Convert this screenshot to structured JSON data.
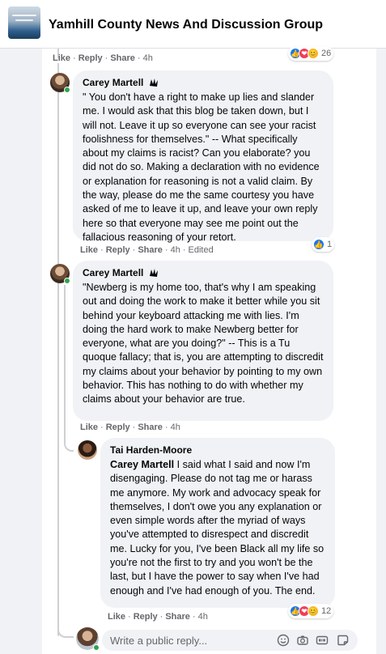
{
  "header": {
    "title": "Yamhill County News And Discussion Group"
  },
  "actions": {
    "like": "Like",
    "reply": "Reply",
    "share": "Share",
    "separator": "·"
  },
  "top_meta": {
    "time": "4h",
    "reaction_count": "26"
  },
  "comments": [
    {
      "author": "Carey Martell",
      "text": "\" You don't have a right to make up lies and slander me. I would ask that this blog be taken down, but I will not. Leave it up so everyone can see your racist foolishness for themselves.\" -- What specifically about my claims is racist? Can you elaborate? you did not do so. Making a declaration with no evidence or explanation for reasoning is not a valid claim. By the way, please do me the same courtesy you have asked of me to leave it up, and leave your own reply here so that everyone may see me point out the fallacious reasoning of your retort.",
      "time": "4h",
      "edited": "Edited",
      "reaction_count": "1"
    },
    {
      "author": "Carey Martell",
      "text": "\"Newberg is my home too, that's why I am speaking out and doing the work to make it better while you sit behind your keyboard attacking me with lies. I'm doing the hard work to make Newberg better for everyone, what are you doing?\" -- This is a Tu quoque fallacy; that is, you are attempting to discredit my claims about your behavior by pointing to my own behavior. This has nothing to do with whether my claims about your behavior are true.",
      "time": "4h"
    },
    {
      "author": "Tai Harden-Moore",
      "mention": "Carey Martell",
      "text": " I said what I said and now I'm disengaging. Please do not tag me or harass me anymore. My work and advocacy speak for themselves, I don't owe you any explanation or even simple words after the myriad of ways you've attempted to disrespect and discredit me. Lucky for you, I've been Black all my life so you're not the first to try and you won't be the last, but I have the power to say when I've had enough and I've had enough of you. The end.",
      "time": "4h",
      "reaction_count": "12"
    }
  ],
  "reply_box": {
    "placeholder": "Write a public reply..."
  },
  "colors": {
    "accent": "#1877f2",
    "meta": "#65676b",
    "bubble": "#f0f2f5",
    "online": "#31a24c"
  },
  "icons": [
    "group-thumbnail",
    "top-fan-badge-icon",
    "like-reaction-icon",
    "love-reaction-icon",
    "care-reaction-icon",
    "emoji-icon",
    "camera-icon",
    "gif-icon",
    "sticker-icon"
  ]
}
